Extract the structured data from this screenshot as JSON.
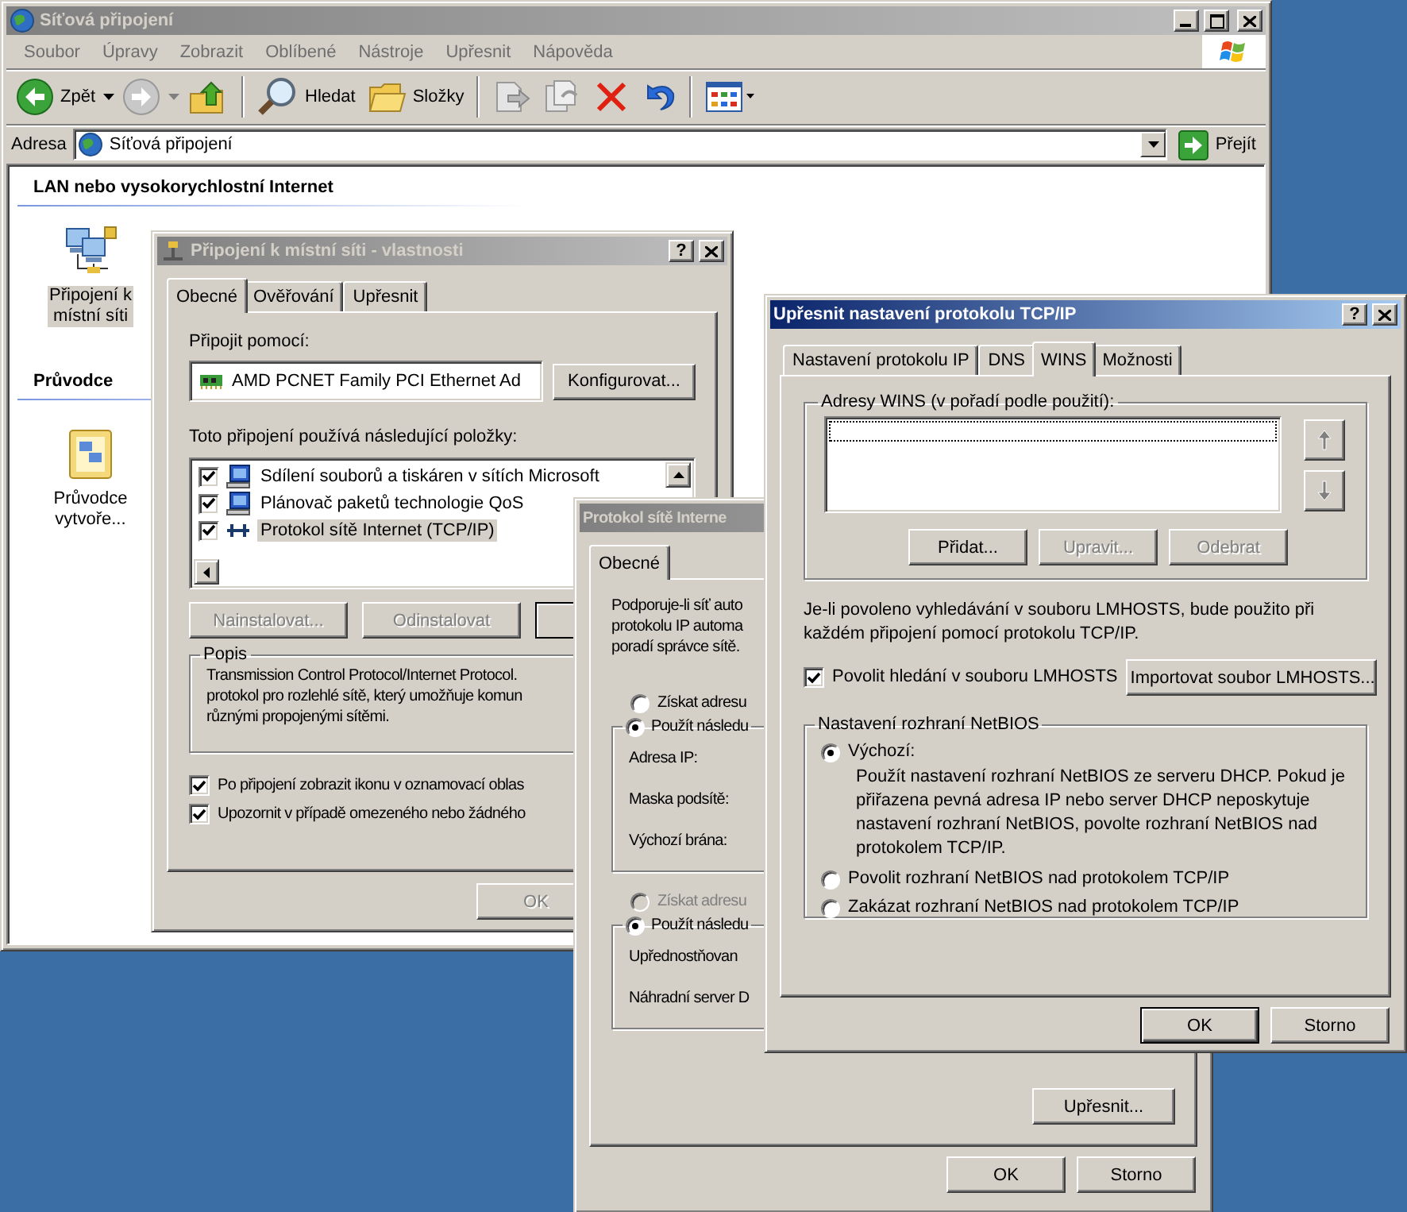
{
  "explorer": {
    "title": "Síťová připojení",
    "active": false,
    "menu": [
      "Soubor",
      "Úpravy",
      "Zobrazit",
      "Oblíbené",
      "Nástroje",
      "Upřesnit",
      "Nápověda"
    ],
    "toolbar": {
      "back": "Zpět",
      "search": "Hledat",
      "folders": "Složky"
    },
    "address": {
      "label": "Adresa",
      "value": "Síťová připojení",
      "go": "Přejít"
    },
    "groups": [
      {
        "header": "LAN nebo vysokorychlostní Internet",
        "items": [
          {
            "label": "Připojení k\nmístní síti",
            "kind": "connection",
            "selected": true
          }
        ]
      },
      {
        "header": "Průvodce",
        "items": [
          {
            "label": "Průvodce\nvytvoře...",
            "kind": "wizard",
            "selected": false
          }
        ]
      }
    ]
  },
  "properties": {
    "title": "Připojení k místní síti - vlastnosti",
    "active": false,
    "help": "?",
    "tabs": [
      {
        "label": "Obecné",
        "selected": true
      },
      {
        "label": "Ověřování",
        "selected": false
      },
      {
        "label": "Upřesnit",
        "selected": false
      }
    ],
    "connect_label": "Připojit pomocí:",
    "adapter": "AMD PCNET Family PCI Ethernet Ad",
    "configure": "Konfigurovat...",
    "components_label": "Toto připojení používá následující položky:",
    "components": [
      {
        "label": "Sdílení souborů a tiskáren v sítích Microsoft",
        "kind": "service",
        "checked": true,
        "selected": false
      },
      {
        "label": "Plánovač paketů technologie QoS",
        "kind": "service",
        "checked": true,
        "selected": false
      },
      {
        "label": "Protokol sítě Internet (TCP/IP)",
        "kind": "protocol",
        "checked": true,
        "selected": true
      }
    ],
    "actions": [
      {
        "label": "Nainstalovat...",
        "disabled": true
      },
      {
        "label": "Odinstalovat",
        "disabled": true
      }
    ],
    "description_title": "Popis",
    "description": "Transmission Control Protocol/Internet Protocol.\nprotokol pro rozlehlé sítě, který umožňuje komun\nrůznými propojenými sítěmi.",
    "options": [
      {
        "label": "Po připojení zobrazit ikonu v oznamovací oblas",
        "checked": true
      },
      {
        "label": "Upozornit v případě omezeného nebo žádného",
        "checked": true
      }
    ],
    "ok": "OK"
  },
  "tcpip": {
    "title": "Protokol sítě Interne",
    "active": false,
    "tabs": [
      {
        "label": "Obecné",
        "selected": true
      }
    ],
    "intro": "Podporuje-li síť auto\nprotokolu IP automa\nporadí správce sítě.",
    "ip_modes": [
      {
        "label": "Získat adresu",
        "selected": false,
        "disabled": false
      },
      {
        "label": "Použít následu",
        "selected": true,
        "disabled": false
      }
    ],
    "ip_fields": [
      "Adresa IP:",
      "Maska podsítě:",
      "Výchozí brána:"
    ],
    "dns_modes": [
      {
        "label": "Získat adresu",
        "selected": false,
        "disabled": true
      },
      {
        "label": "Použít následu",
        "selected": true,
        "disabled": false
      }
    ],
    "dns_fields": [
      "Upřednostňovan",
      "Náhradní server D"
    ],
    "advanced": "Upřesnit...",
    "ok": "OK",
    "cancel": "Storno"
  },
  "advanced": {
    "title": "Upřesnit nastavení protokolu TCP/IP",
    "active": true,
    "help": "?",
    "tabs": [
      {
        "label": "Nastavení protokolu IP",
        "selected": false
      },
      {
        "label": "DNS",
        "selected": false
      },
      {
        "label": "WINS",
        "selected": true
      },
      {
        "label": "Možnosti",
        "selected": false
      }
    ],
    "wins_label": "Adresy WINS (v pořadí podle použití):",
    "wins_buttons": [
      {
        "label": "Přidat...",
        "disabled": false
      },
      {
        "label": "Upravit...",
        "disabled": true
      },
      {
        "label": "Odebrat",
        "disabled": true
      }
    ],
    "lmhosts_note": "Je-li povoleno vyhledávání v souboru LMHOSTS, bude použito při každém připojení pomocí protokolu TCP/IP.",
    "lmhosts_lookup": {
      "label": "Povolit hledání v souboru LMHOSTS",
      "checked": true
    },
    "import": "Importovat soubor LMHOSTS...",
    "netbios_label": "Nastavení rozhraní NetBIOS",
    "netbios": [
      {
        "label": "Výchozí:",
        "selected": true,
        "description": "Použít nastavení rozhraní NetBIOS ze serveru DHCP. Pokud je přiřazena pevná adresa IP nebo server DHCP neposkytuje nastavení rozhraní NetBIOS, povolte rozhraní NetBIOS nad protokolem TCP/IP."
      },
      {
        "label": "Povolit rozhraní NetBIOS nad protokolem TCP/IP",
        "selected": false
      },
      {
        "label": "Zakázat rozhraní NetBIOS nad protokolem TCP/IP",
        "selected": false
      }
    ],
    "ok": "OK",
    "cancel": "Storno"
  }
}
